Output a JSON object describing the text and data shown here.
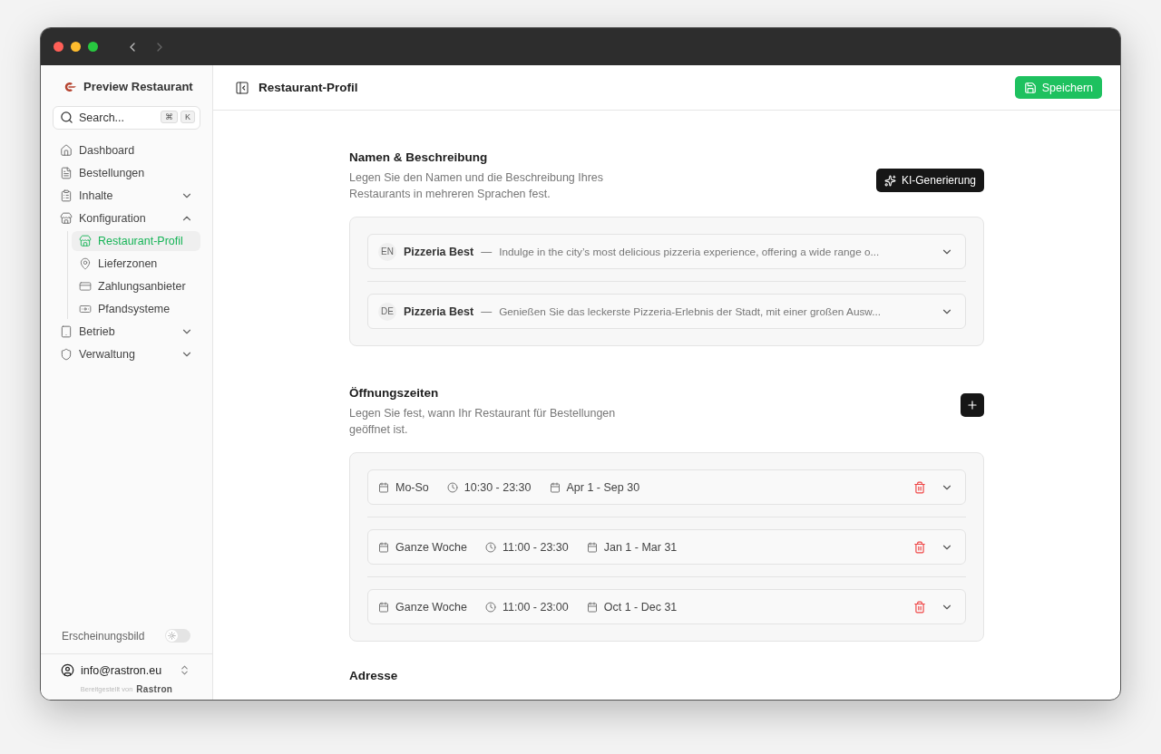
{
  "sidebar": {
    "brand": "Preview Restaurant",
    "search": {
      "placeholder": "Search...",
      "keys": [
        "⌘",
        "K"
      ]
    },
    "items": [
      {
        "label": "Dashboard"
      },
      {
        "label": "Bestellungen"
      },
      {
        "label": "Inhalte",
        "expanded": false
      },
      {
        "label": "Konfiguration",
        "expanded": true,
        "children": [
          {
            "label": "Restaurant-Profil",
            "selected": true
          },
          {
            "label": "Lieferzonen",
            "selected": false
          },
          {
            "label": "Zahlungsanbieter",
            "selected": false
          },
          {
            "label": "Pfandsysteme",
            "selected": false
          }
        ]
      },
      {
        "label": "Betrieb",
        "expanded": false
      },
      {
        "label": "Verwaltung",
        "expanded": false
      }
    ],
    "appearance": {
      "label": "Erscheinungsbild",
      "on": false
    },
    "user": "info@rastron.eu",
    "powered_by": "Bereitgestellt von",
    "powered_logo": "Rastron"
  },
  "header": {
    "title": "Restaurant-Profil",
    "save": "Speichern"
  },
  "names": {
    "title": "Namen & Beschreibung",
    "description": "Legen Sie den Namen und die Beschreibung Ihres Restaurants in mehreren Sprachen fest.",
    "ai_button": "KI-Generierung",
    "languages": [
      {
        "code": "EN",
        "name": "Pizzeria Best",
        "separator": "—",
        "text": "Indulge in the city’s most delicious pizzeria experience, offering a wide range o..."
      },
      {
        "code": "DE",
        "name": "Pizzeria Best",
        "separator": "—",
        "text": "Genießen Sie das leckerste Pizzeria-Erlebnis der Stadt, mit einer großen Ausw..."
      }
    ]
  },
  "hours": {
    "title": "Öffnungszeiten",
    "description": "Legen Sie fest, wann Ihr Restaurant für Bestellungen geöffnet ist.",
    "entries": [
      {
        "days": "Mo-So",
        "time": "10:30 - 23:30",
        "period": "Apr 1 - Sep 30"
      },
      {
        "days": "Ganze Woche",
        "time": "11:00 - 23:30",
        "period": "Jan 1 - Mar 31"
      },
      {
        "days": "Ganze Woche",
        "time": "11:00 - 23:00",
        "period": "Oct 1 - Dec 31"
      }
    ]
  },
  "address": {
    "title": "Adresse"
  }
}
